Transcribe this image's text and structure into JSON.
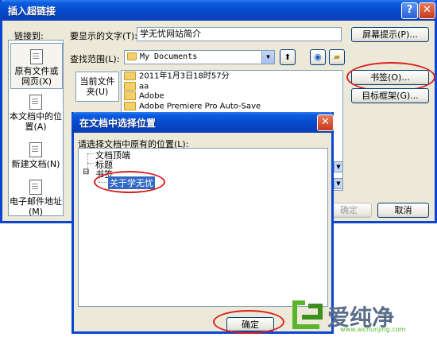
{
  "main_dialog": {
    "title": "插入超链接",
    "help_btn": "?",
    "close_btn": "✕",
    "link_to_label": "链接到:",
    "sidebar": [
      {
        "label": "原有文件或网页",
        "key": "(X)"
      },
      {
        "label": "本文档中的位置",
        "key": "(A)"
      },
      {
        "label": "新建文档",
        "key": "(N)"
      },
      {
        "label": "电子邮件地址",
        "key": "(M)"
      }
    ],
    "display_text_label": "要显示的文字(T):",
    "display_text_value": "学无忧网站简介",
    "screen_tip_button": "屏幕提示(P)...",
    "look_in_label": "查找范围(L):",
    "look_in_value": "My Documents",
    "current_folder_label": "当前文件夹(U)",
    "files": [
      "2011年1月3日18时57分",
      "aa",
      "Adobe",
      "Adobe Premiere Pro Auto-Save"
    ],
    "bookmark_button": "书签(O)...",
    "target_frame_button": "目标框架(G)...",
    "ok_button": "确定",
    "cancel_button": "取消"
  },
  "sub_dialog": {
    "title": "在文档中选择位置",
    "close_btn": "✕",
    "prompt": "请选择文档中原有的位置(L):",
    "tree": {
      "top": "文档顶端",
      "headings": "标题",
      "bookmarks": "书签",
      "selected_bookmark": "关于学无忧",
      "expander": "⊟"
    },
    "ok_button": "确定"
  },
  "watermark": {
    "brand": "爱纯净",
    "url": "www.aichunjing.com"
  },
  "colors": {
    "titlebar": "#0747c9",
    "dialog_bg": "#ece9d8",
    "highlight": "#316ac5",
    "annotation": "#d92020",
    "watermark_green": "#5ab52a"
  }
}
